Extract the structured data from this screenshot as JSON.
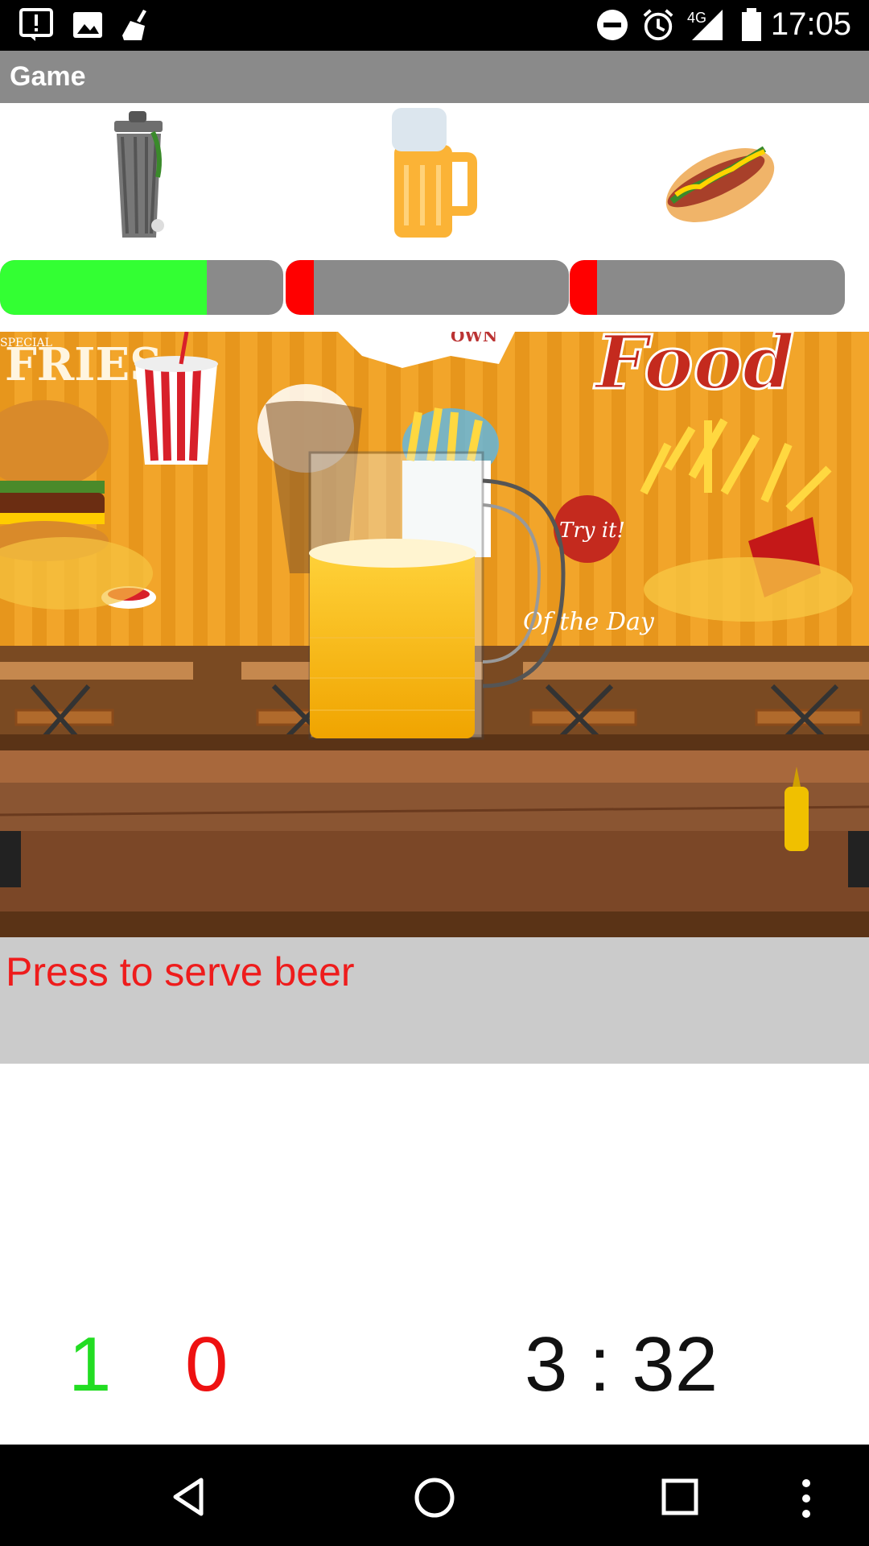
{
  "status_bar": {
    "time": "17:05",
    "network": "4G",
    "icons": [
      "alert-icon",
      "image-icon",
      "broom-icon",
      "dnd-icon",
      "alarm-icon",
      "signal-icon",
      "battery-icon"
    ]
  },
  "title_bar": {
    "title": "Game"
  },
  "items": [
    {
      "name": "trash-can-icon",
      "level": 0.73,
      "fill_color": "#33ff33"
    },
    {
      "name": "beer-mug-icon",
      "level": 0.1,
      "fill_color": "#ff0000"
    },
    {
      "name": "hotdog-icon",
      "level": 0.1,
      "fill_color": "#ff0000"
    }
  ],
  "scene": {
    "background_sign_text": [
      "FRIES",
      "Food",
      "Try it!",
      "Of the Day",
      "SPECIAL",
      "OWN"
    ]
  },
  "message": {
    "text": "Press to serve beer"
  },
  "scores": {
    "green": "1",
    "red": "0"
  },
  "timer": {
    "text": "3 : 32"
  },
  "colors": {
    "bar_background": "#8a8a8a",
    "title_bar": "#8a8a8a",
    "message_text": "#ee1c1c",
    "message_panel": "#cbcbcb"
  }
}
